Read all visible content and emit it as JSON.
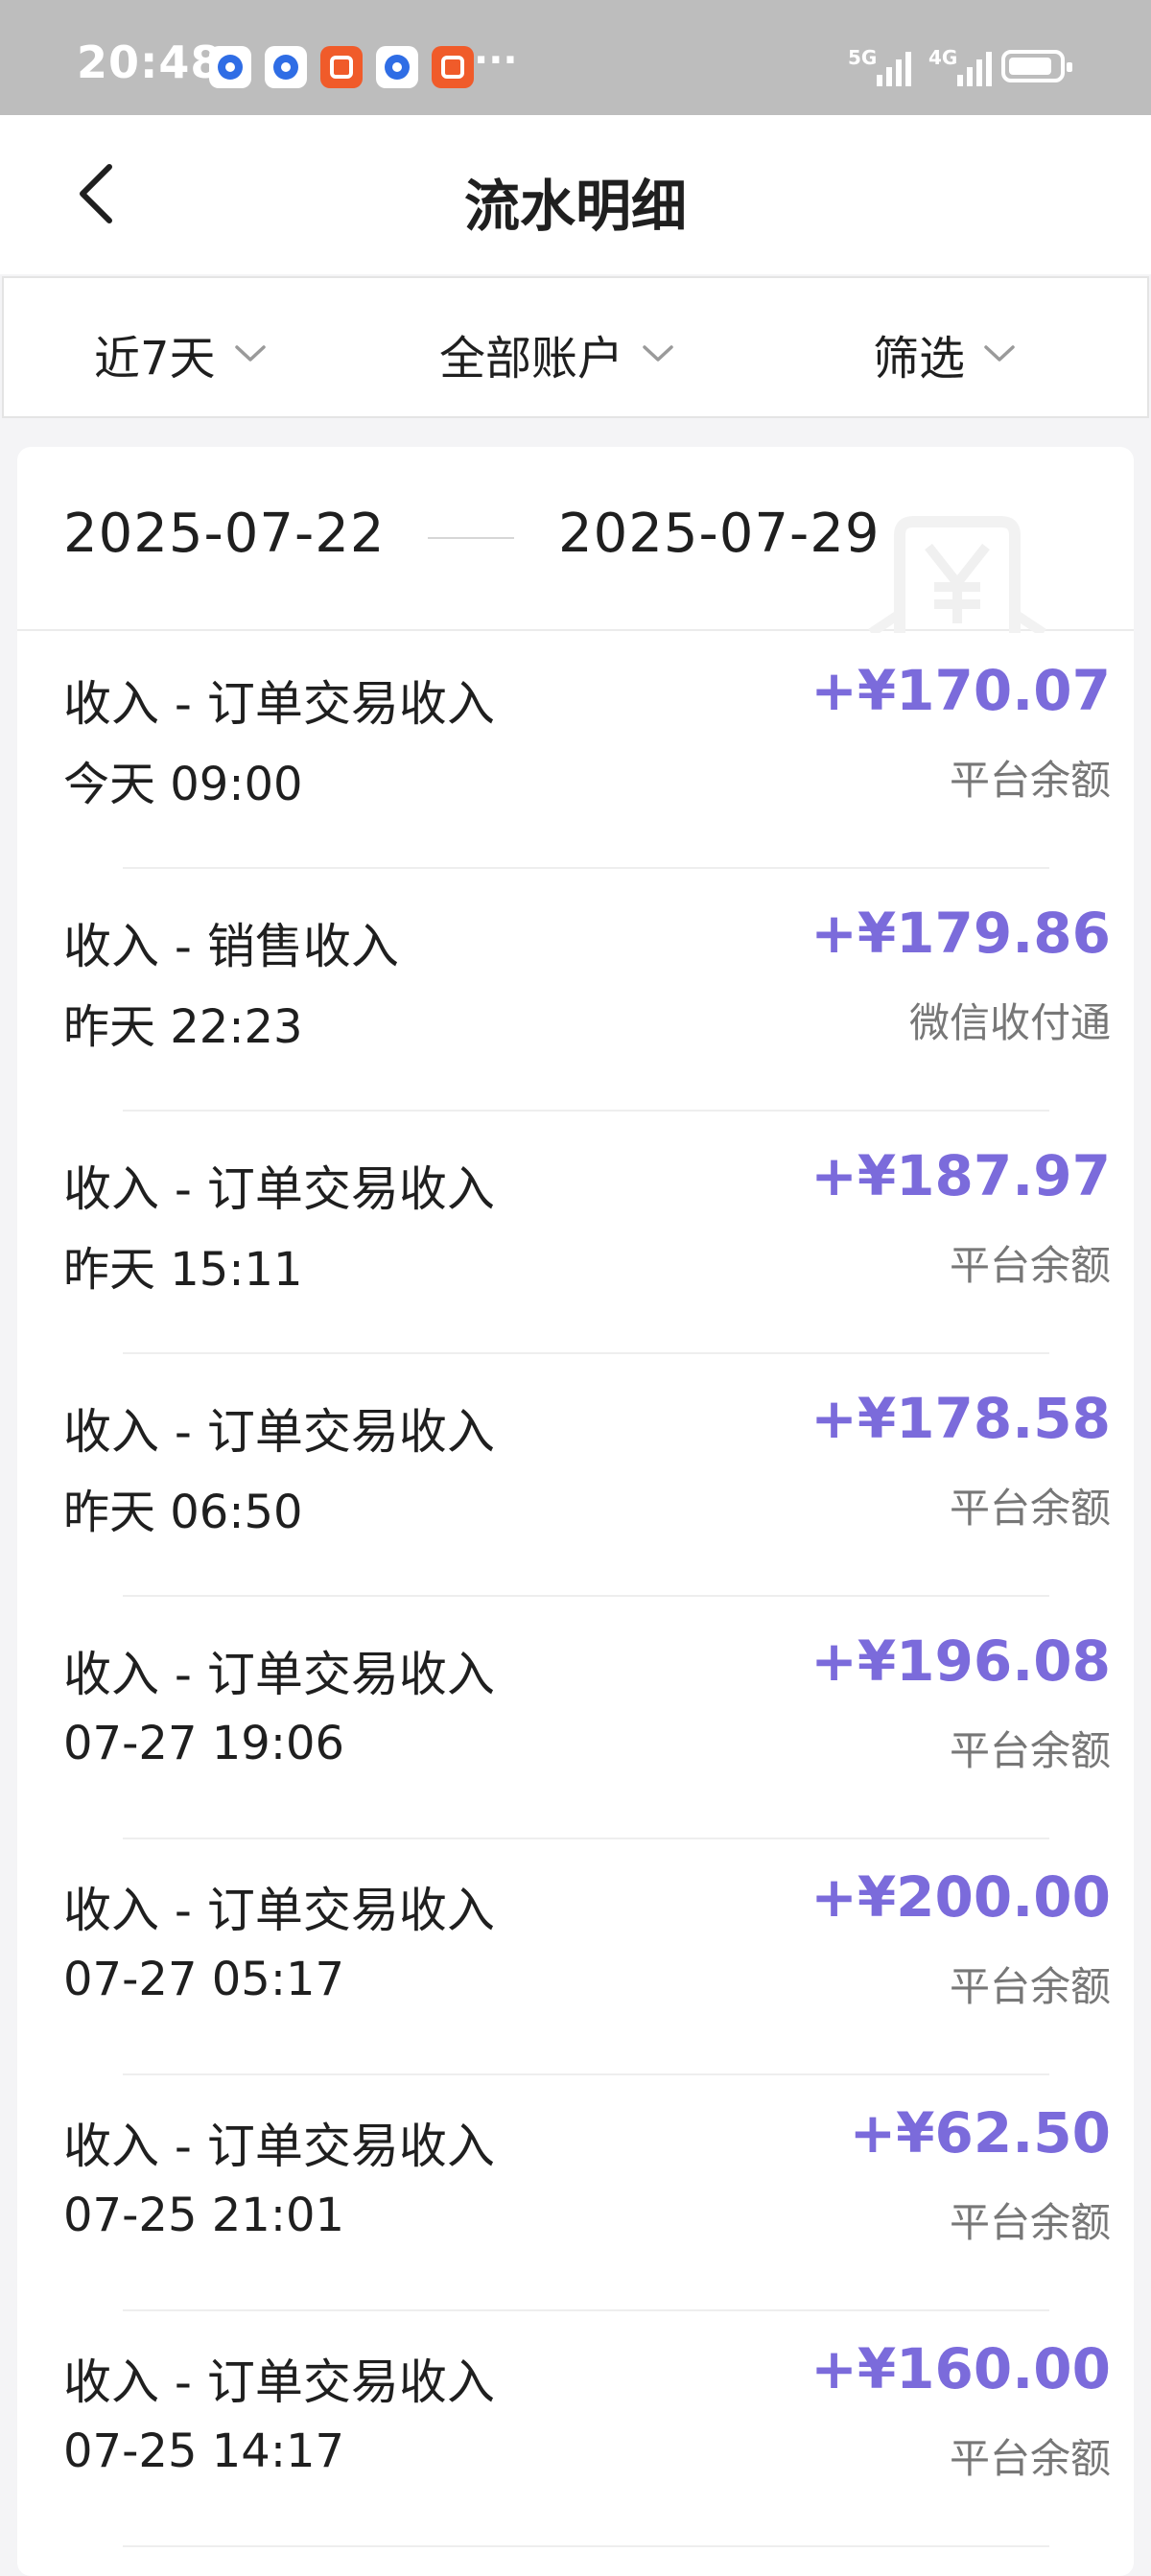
{
  "status_bar": {
    "time": "20:48",
    "more": "···",
    "network_1": "5G",
    "network_2": "4G"
  },
  "header": {
    "title": "流水明细",
    "back_icon": "chevron-left-icon"
  },
  "filters": {
    "period": "近7天",
    "account": "全部账户",
    "filter": "筛选"
  },
  "date_range": {
    "start": "2025-07-22",
    "end": "2025-07-29"
  },
  "colors": {
    "amount": "#7b6bdb",
    "status_bar": "#bdbdbd"
  },
  "transactions": [
    {
      "title": "收入 - 订单交易收入",
      "time": "今天 09:00",
      "amount": "+¥170.07",
      "account": "平台余额"
    },
    {
      "title": "收入 - 销售收入",
      "time": "昨天 22:23",
      "amount": "+¥179.86",
      "account": "微信收付通"
    },
    {
      "title": "收入 - 订单交易收入",
      "time": "昨天 15:11",
      "amount": "+¥187.97",
      "account": "平台余额"
    },
    {
      "title": "收入 - 订单交易收入",
      "time": "昨天 06:50",
      "amount": "+¥178.58",
      "account": "平台余额"
    },
    {
      "title": "收入 - 订单交易收入",
      "time": "07-27 19:06",
      "amount": "+¥196.08",
      "account": "平台余额"
    },
    {
      "title": "收入 - 订单交易收入",
      "time": "07-27 05:17",
      "amount": "+¥200.00",
      "account": "平台余额"
    },
    {
      "title": "收入 - 订单交易收入",
      "time": "07-25 21:01",
      "amount": "+¥62.50",
      "account": "平台余额"
    },
    {
      "title": "收入 - 订单交易收入",
      "time": "07-25 14:17",
      "amount": "+¥160.00",
      "account": "平台余额"
    }
  ]
}
